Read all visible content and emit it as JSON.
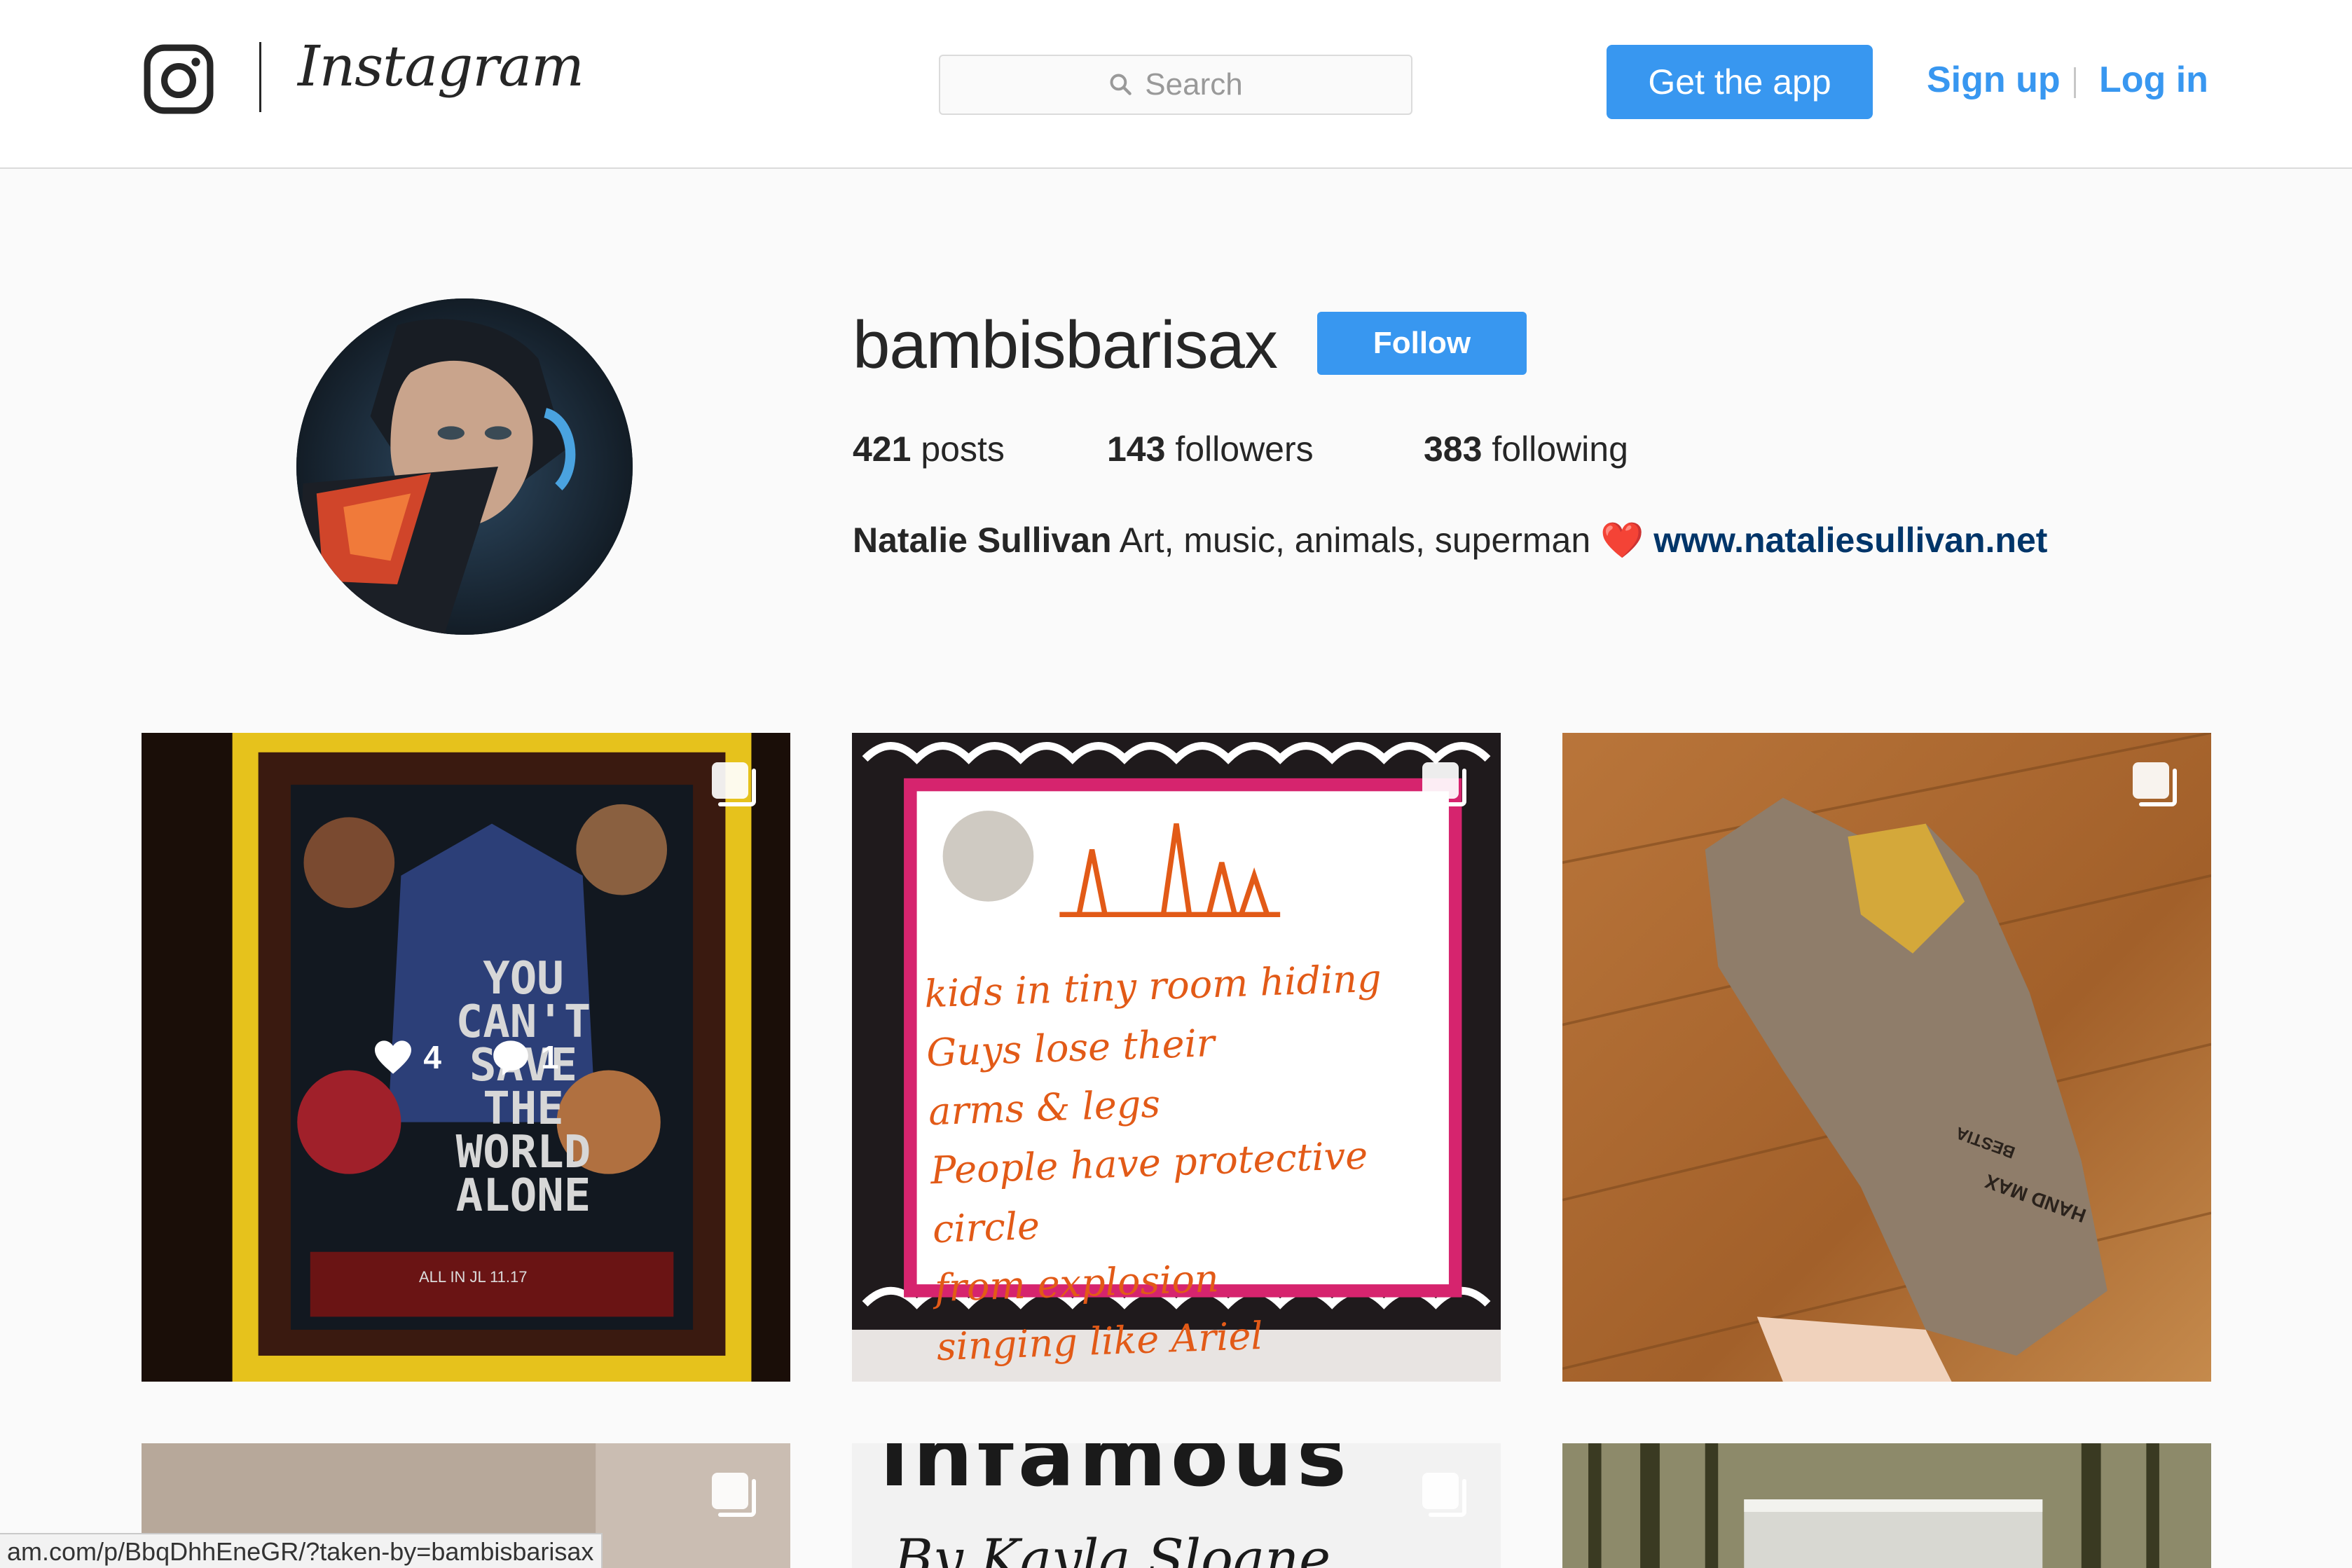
{
  "header": {
    "logo": "instagram-camera-icon",
    "wordmark": "Instagram",
    "search_placeholder": "Search",
    "get_app_label": "Get the app",
    "sign_up_label": "Sign up",
    "log_in_label": "Log in"
  },
  "profile": {
    "username": "bambisbarisax",
    "follow_label": "Follow",
    "posts_count": "421",
    "posts_label": "posts",
    "followers_count": "143",
    "followers_label": "followers",
    "following_count": "383",
    "following_label": "following",
    "full_name": "Natalie Sullivan",
    "bio_text": "Art, music, animals, superman",
    "bio_emoji": "❤️",
    "website": "www.nataliesullivan.net"
  },
  "posts": [
    {
      "kind": "movie poster",
      "multi": true,
      "likes": "4",
      "comments": "1",
      "poster_text": [
        "YOU",
        "CAN'T",
        "SAVE",
        "THE",
        "WORLD",
        "ALONE"
      ],
      "poster_footer": "ALL IN JL 11.17"
    },
    {
      "kind": "handwritten note",
      "multi": true,
      "note_lines": [
        "kids in tiny room hiding",
        "Guys lose their",
        "arms & legs",
        "People have protective circle",
        "from explosion",
        "singing like Ariel"
      ]
    },
    {
      "kind": "work glove",
      "multi": true,
      "glove_brand": "HAND MAX",
      "glove_model": "BESTIA"
    },
    {
      "kind": "wall",
      "multi": true
    },
    {
      "kind": "book cover",
      "multi": true,
      "cover_title": "Infamous",
      "cover_author": "By Kayla Sloane"
    },
    {
      "kind": "trees",
      "multi": false
    }
  ],
  "status_bar": {
    "url": "am.com/p/BbqDhhEneGR/?taken-by=bambisbarisax"
  },
  "colors": {
    "brand_blue": "#3897f0",
    "link_navy": "#003569",
    "background": "#fafafa",
    "border": "#dbdbdb"
  }
}
